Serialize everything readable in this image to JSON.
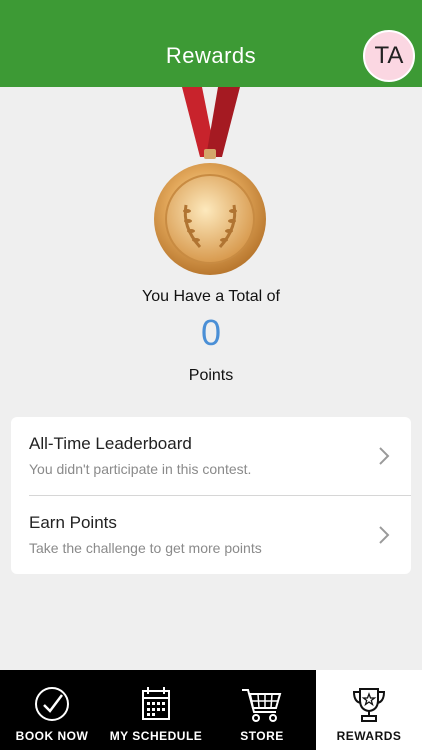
{
  "header": {
    "title": "Rewards",
    "avatar_initials": "TA"
  },
  "summary": {
    "total_label": "You Have a Total of",
    "points_value": "0",
    "points_label": "Points"
  },
  "list": [
    {
      "title": "All-Time Leaderboard",
      "subtitle": "You didn't participate in this contest."
    },
    {
      "title": "Earn Points",
      "subtitle": "Take the challenge to get more points"
    }
  ],
  "tabs": [
    {
      "label": "BOOK NOW",
      "icon": "checkmark-circle-icon",
      "active": false
    },
    {
      "label": "MY SCHEDULE",
      "icon": "calendar-icon",
      "active": false
    },
    {
      "label": "STORE",
      "icon": "cart-icon",
      "active": false
    },
    {
      "label": "REWARDS",
      "icon": "trophy-icon",
      "active": true
    }
  ],
  "colors": {
    "header_bg": "#3d9a35",
    "points_value": "#4a8fd6",
    "avatar_bg": "#fbd7e2",
    "tabbar_bg": "#000000"
  }
}
